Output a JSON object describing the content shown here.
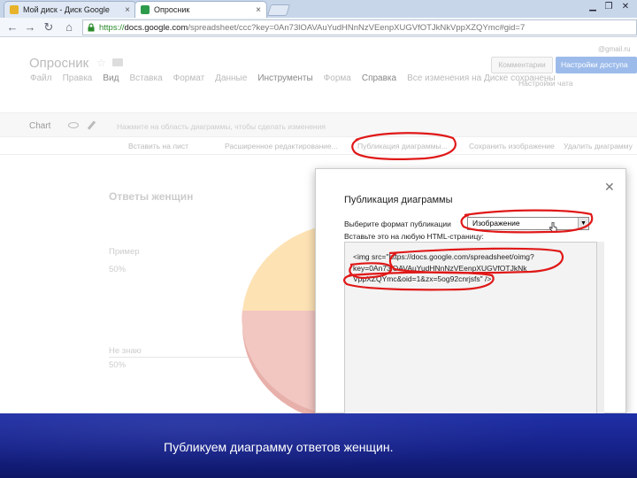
{
  "browser": {
    "tabs": [
      {
        "label": "Мой диск - Диск Google",
        "active": false,
        "icon_color": "#e8b32a"
      },
      {
        "label": "Опросник",
        "active": true,
        "icon_color": "#2d9b4c"
      }
    ],
    "address": {
      "scheme": "https://",
      "domain": "docs.google.com",
      "path": "/spreadsheet/ccc?key=0An73lOAVAuYudHNnNzVEenpXUGVfOTJkNkVppXZQYmc#gid=7"
    }
  },
  "app": {
    "doc_title": "Опросник",
    "account_email": "@gmail.ru",
    "comments_button": "Комментарии",
    "access_button": "Настройки доступа",
    "menu": [
      "Файл",
      "Правка",
      "Вид",
      "Вставка",
      "Формат",
      "Данные",
      "Инструменты",
      "Форма",
      "Справка",
      "Все изменения на Диске сохранены"
    ],
    "settings_link": "Настройки чата",
    "chart_bar": {
      "label": "Chart",
      "hint": "Нажмите на область диаграммы, чтобы сделать изменения"
    },
    "chart_menu": [
      "Вставить на лист",
      "Расширенное редактирование...",
      "Публикация диаграммы...",
      "Сохранить изображение",
      "Удалить диаграмму"
    ],
    "chart_title": "Ответы женщин",
    "legend": [
      {
        "label": "Пример",
        "value": "50%"
      },
      {
        "label": "Не знаю",
        "value": "50%"
      }
    ]
  },
  "dialog": {
    "title": "Публикация диаграммы",
    "format_label": "Выберите формат публикации",
    "format_value": "Изображение",
    "embed_label": "Вставьте это на любую HTML-страницу:",
    "embed_code": "<img src=\"https://docs.google.com/spreadsheet/oimg?\nkey=0An73lOAVAuYudHNnNzVEenpXUGVfOTJkNk\nVppXZQYmc&oid=1&zx=5og92cnrjsfs\" />"
  },
  "caption": "Публикуем диаграмму ответов женщин.",
  "colors": {
    "annotation_red": "#e01818",
    "banner_blue": "#16228a",
    "pie_yellow": "#fde2b4",
    "pie_red": "#f2c6c1"
  }
}
